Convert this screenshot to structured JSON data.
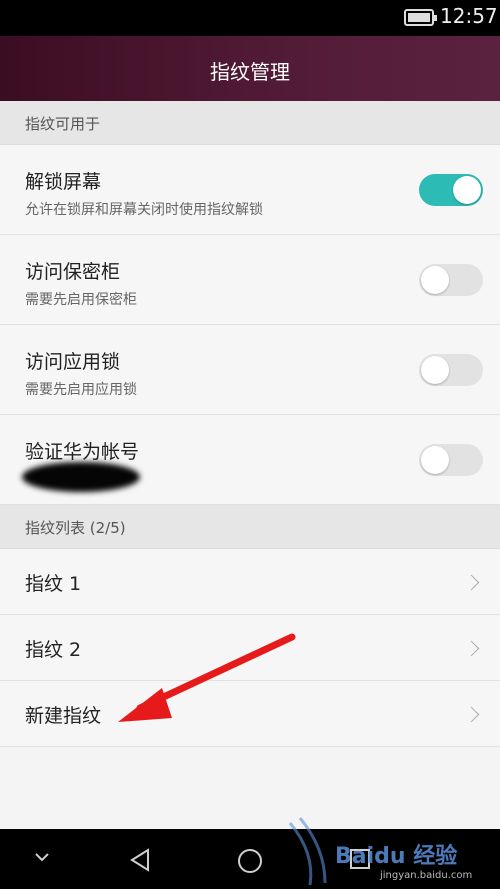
{
  "status_bar": {
    "time": "12:57"
  },
  "app_bar": {
    "title": "指纹管理"
  },
  "section_usage": {
    "label": "指纹可用于"
  },
  "settings": [
    {
      "title": "解锁屏幕",
      "subtitle": "允许在锁屏和屏幕关闭时使用指纹解锁",
      "enabled": true
    },
    {
      "title": "访问保密柜",
      "subtitle": "需要先启用保密柜",
      "enabled": false
    },
    {
      "title": "访问应用锁",
      "subtitle": "需要先启用应用锁",
      "enabled": false
    },
    {
      "title": "验证华为帐号",
      "subtitle": "",
      "enabled": false
    }
  ],
  "section_list": {
    "label": "指纹列表 (2/5)"
  },
  "fingerprints": [
    {
      "label": "指纹 1"
    },
    {
      "label": "指纹 2"
    },
    {
      "label": "新建指纹"
    }
  ],
  "colors": {
    "accent": "#2dbbb6",
    "appbar": "#4a1530",
    "annotation_arrow": "#e61a1a"
  },
  "watermark": {
    "logo": "Baidu 经验",
    "url": "jingyan.baidu.com"
  }
}
